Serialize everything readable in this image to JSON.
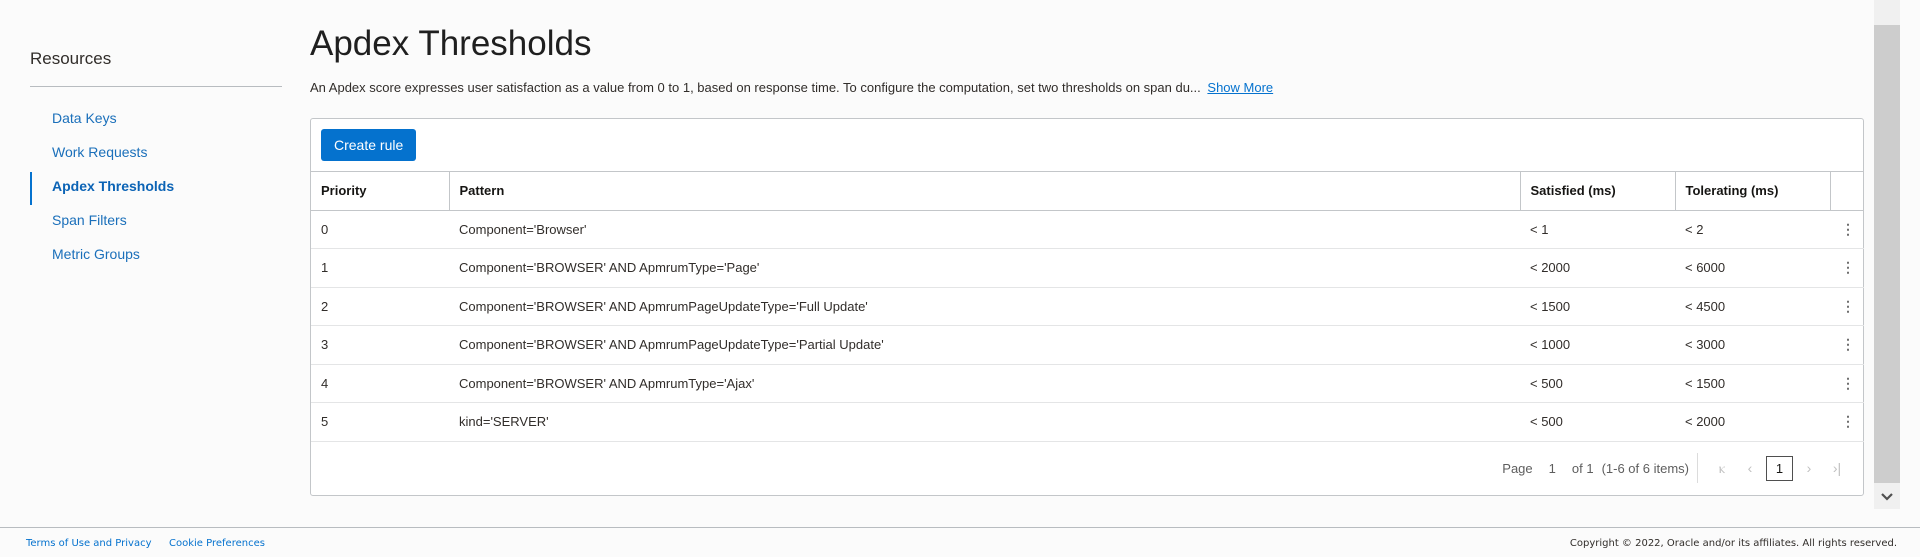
{
  "sidebar": {
    "title": "Resources",
    "items": [
      {
        "label": "Data Keys",
        "active": false
      },
      {
        "label": "Work Requests",
        "active": false
      },
      {
        "label": "Apdex Thresholds",
        "active": true
      },
      {
        "label": "Span Filters",
        "active": false
      },
      {
        "label": "Metric Groups",
        "active": false
      }
    ]
  },
  "main": {
    "title": "Apdex Thresholds",
    "description": "An Apdex score expresses user satisfaction as a value from 0 to 1, based on response time. To configure the computation, set two thresholds on span du...",
    "show_more_label": "Show More",
    "create_button_label": "Create rule",
    "table": {
      "columns": [
        "Priority",
        "Pattern",
        "Satisfied (ms)",
        "Tolerating (ms)",
        ""
      ],
      "rows": [
        {
          "priority": "0",
          "pattern": "Component='Browser'",
          "satisfied": "< 1",
          "tolerating": "< 2"
        },
        {
          "priority": "1",
          "pattern": "Component='BROWSER' AND ApmrumType='Page'",
          "satisfied": "< 2000",
          "tolerating": "< 6000"
        },
        {
          "priority": "2",
          "pattern": "Component='BROWSER' AND ApmrumPageUpdateType='Full Update'",
          "satisfied": "< 1500",
          "tolerating": "< 4500"
        },
        {
          "priority": "3",
          "pattern": "Component='BROWSER' AND ApmrumPageUpdateType='Partial Update'",
          "satisfied": "< 1000",
          "tolerating": "< 3000"
        },
        {
          "priority": "4",
          "pattern": "Component='BROWSER' AND ApmrumType='Ajax'",
          "satisfied": "< 500",
          "tolerating": "< 1500"
        },
        {
          "priority": "5",
          "pattern": "kind='SERVER'",
          "satisfied": "< 500",
          "tolerating": "< 2000"
        }
      ]
    },
    "pagination": {
      "page_label": "Page",
      "current_page": "1",
      "of_label": "of 1",
      "range_label": "(1-6 of 6 items)",
      "page_button": "1",
      "icons": {
        "first": "first-page-icon",
        "prev": "previous-page-icon",
        "next": "next-page-icon",
        "last": "last-page-icon"
      }
    }
  },
  "footer": {
    "terms_label": "Terms of Use and Privacy",
    "cookie_label": "Cookie Preferences",
    "copyright": "Copyright © 2022, Oracle and/or its affiliates. All rights reserved."
  },
  "colors": {
    "accent": "#0572ce",
    "link": "#1a6fba",
    "text": "#312d2a"
  }
}
